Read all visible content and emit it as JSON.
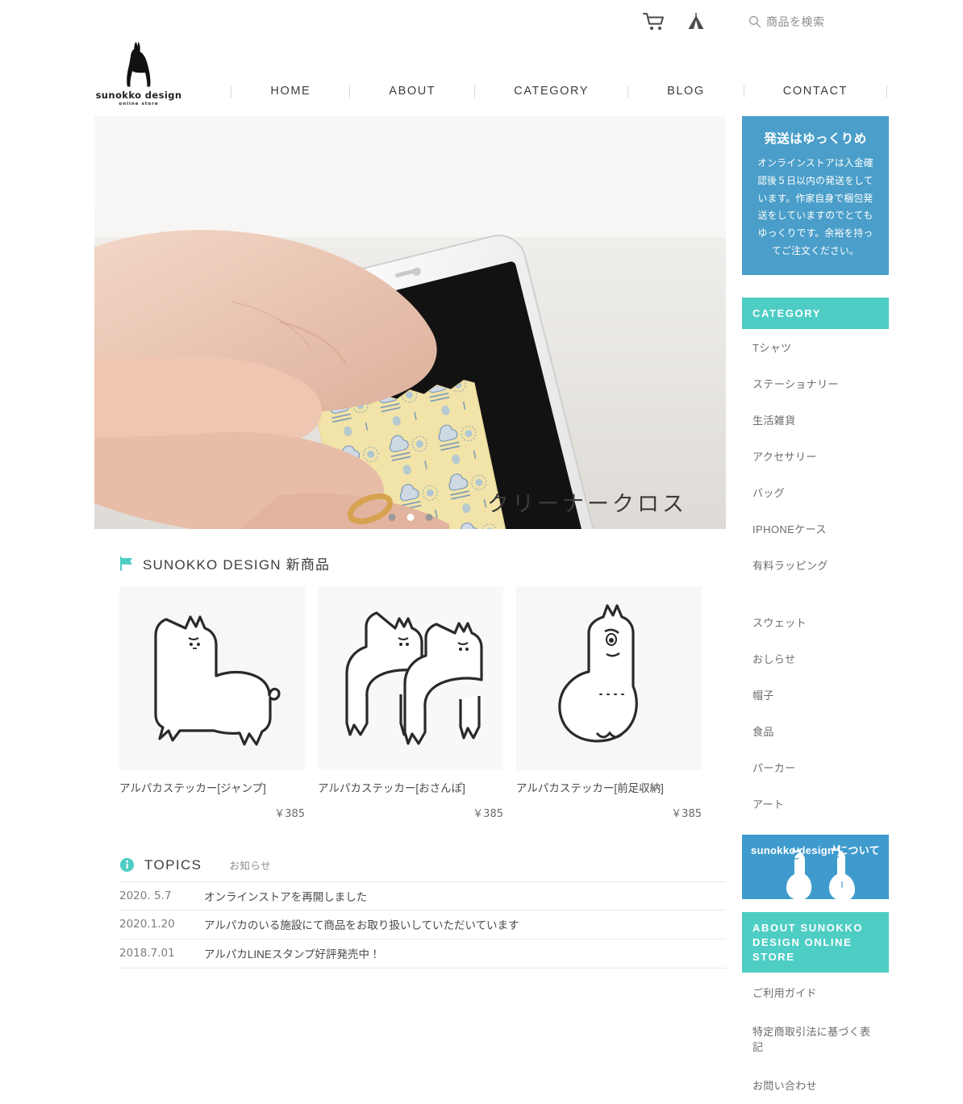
{
  "utility": {
    "cart_icon": "cart-icon",
    "tent_icon": "tent-icon",
    "search_icon": "search-icon",
    "search_placeholder": "商品を検索",
    "search_value": ""
  },
  "brand": {
    "logo_icon": "alpaca-logo-icon",
    "name": "sunokko design",
    "tagline": "online store"
  },
  "nav": {
    "items": [
      {
        "label": "HOME"
      },
      {
        "label": "ABOUT"
      },
      {
        "label": "CATEGORY"
      },
      {
        "label": "BLOG"
      },
      {
        "label": "CONTACT"
      }
    ]
  },
  "hero": {
    "caption": "クリーナークロス",
    "slides": 3,
    "active_slide": 2,
    "alt": "手に持ったスマートフォンをアルパカ柄のクリーナークロスで拭いている写真"
  },
  "new_products": {
    "flag_icon": "flag-icon",
    "heading": "SUNOKKO DESIGN 新商品",
    "items": [
      {
        "name": "アルパカステッカー[ジャンプ]",
        "price": "￥385",
        "art": "alpaca-jump"
      },
      {
        "name": "アルパカステッカー[おさんぽ]",
        "price": "￥385",
        "art": "alpaca-walk-pair"
      },
      {
        "name": "アルパカステッカー[前足収納]",
        "price": "￥385",
        "art": "alpaca-sitting"
      }
    ]
  },
  "topics": {
    "info_icon": "info-icon",
    "label": "TOPICS",
    "sublabel": "お知らせ",
    "rows": [
      {
        "date": "2020. 5.7",
        "title": "オンラインストアを再開しました"
      },
      {
        "date": "2020.1.20",
        "title": "アルパカのいる施設にて商品をお取り扱いしていただいています"
      },
      {
        "date": "2018.7.01",
        "title": "アルパカLINEスタンプ好評発売中！"
      }
    ]
  },
  "sidebar": {
    "notice": {
      "title": "発送はゆっくりめ",
      "body": "オンラインストアは入金確認後５日以内の発送をしています。作家自身で梱包発送をしていますのでとてもゆっくりです。余裕を持ってご注文ください。"
    },
    "category_heading": "CATEGORY",
    "categories": [
      {
        "label": "Tシャツ"
      },
      {
        "label": "ステーショナリー"
      },
      {
        "label": "生活雑貨"
      },
      {
        "label": "アクセサリー"
      },
      {
        "label": "バッグ"
      },
      {
        "label": "IPHONEケース"
      },
      {
        "label": "有料ラッピング"
      },
      {
        "label": ""
      },
      {
        "label": "スウェット"
      },
      {
        "label": "おしらせ"
      },
      {
        "label": "帽子"
      },
      {
        "label": "食品"
      },
      {
        "label": "パーカー"
      },
      {
        "label": "アート"
      }
    ],
    "about_banner": {
      "text": "sunokko design について",
      "art": "two-white-alpacas"
    },
    "about_heading": "ABOUT SUNOKKO DESIGN ONLINE STORE",
    "links": [
      {
        "label": "ご利用ガイド"
      },
      {
        "label": "特定商取引法に基づく表記"
      },
      {
        "label": "お問い合わせ"
      }
    ]
  },
  "colors": {
    "teal": "#4ECDC4",
    "blue": "#4a9ec9",
    "banner_blue": "#3f9bcd",
    "text": "#4a4a4a"
  }
}
